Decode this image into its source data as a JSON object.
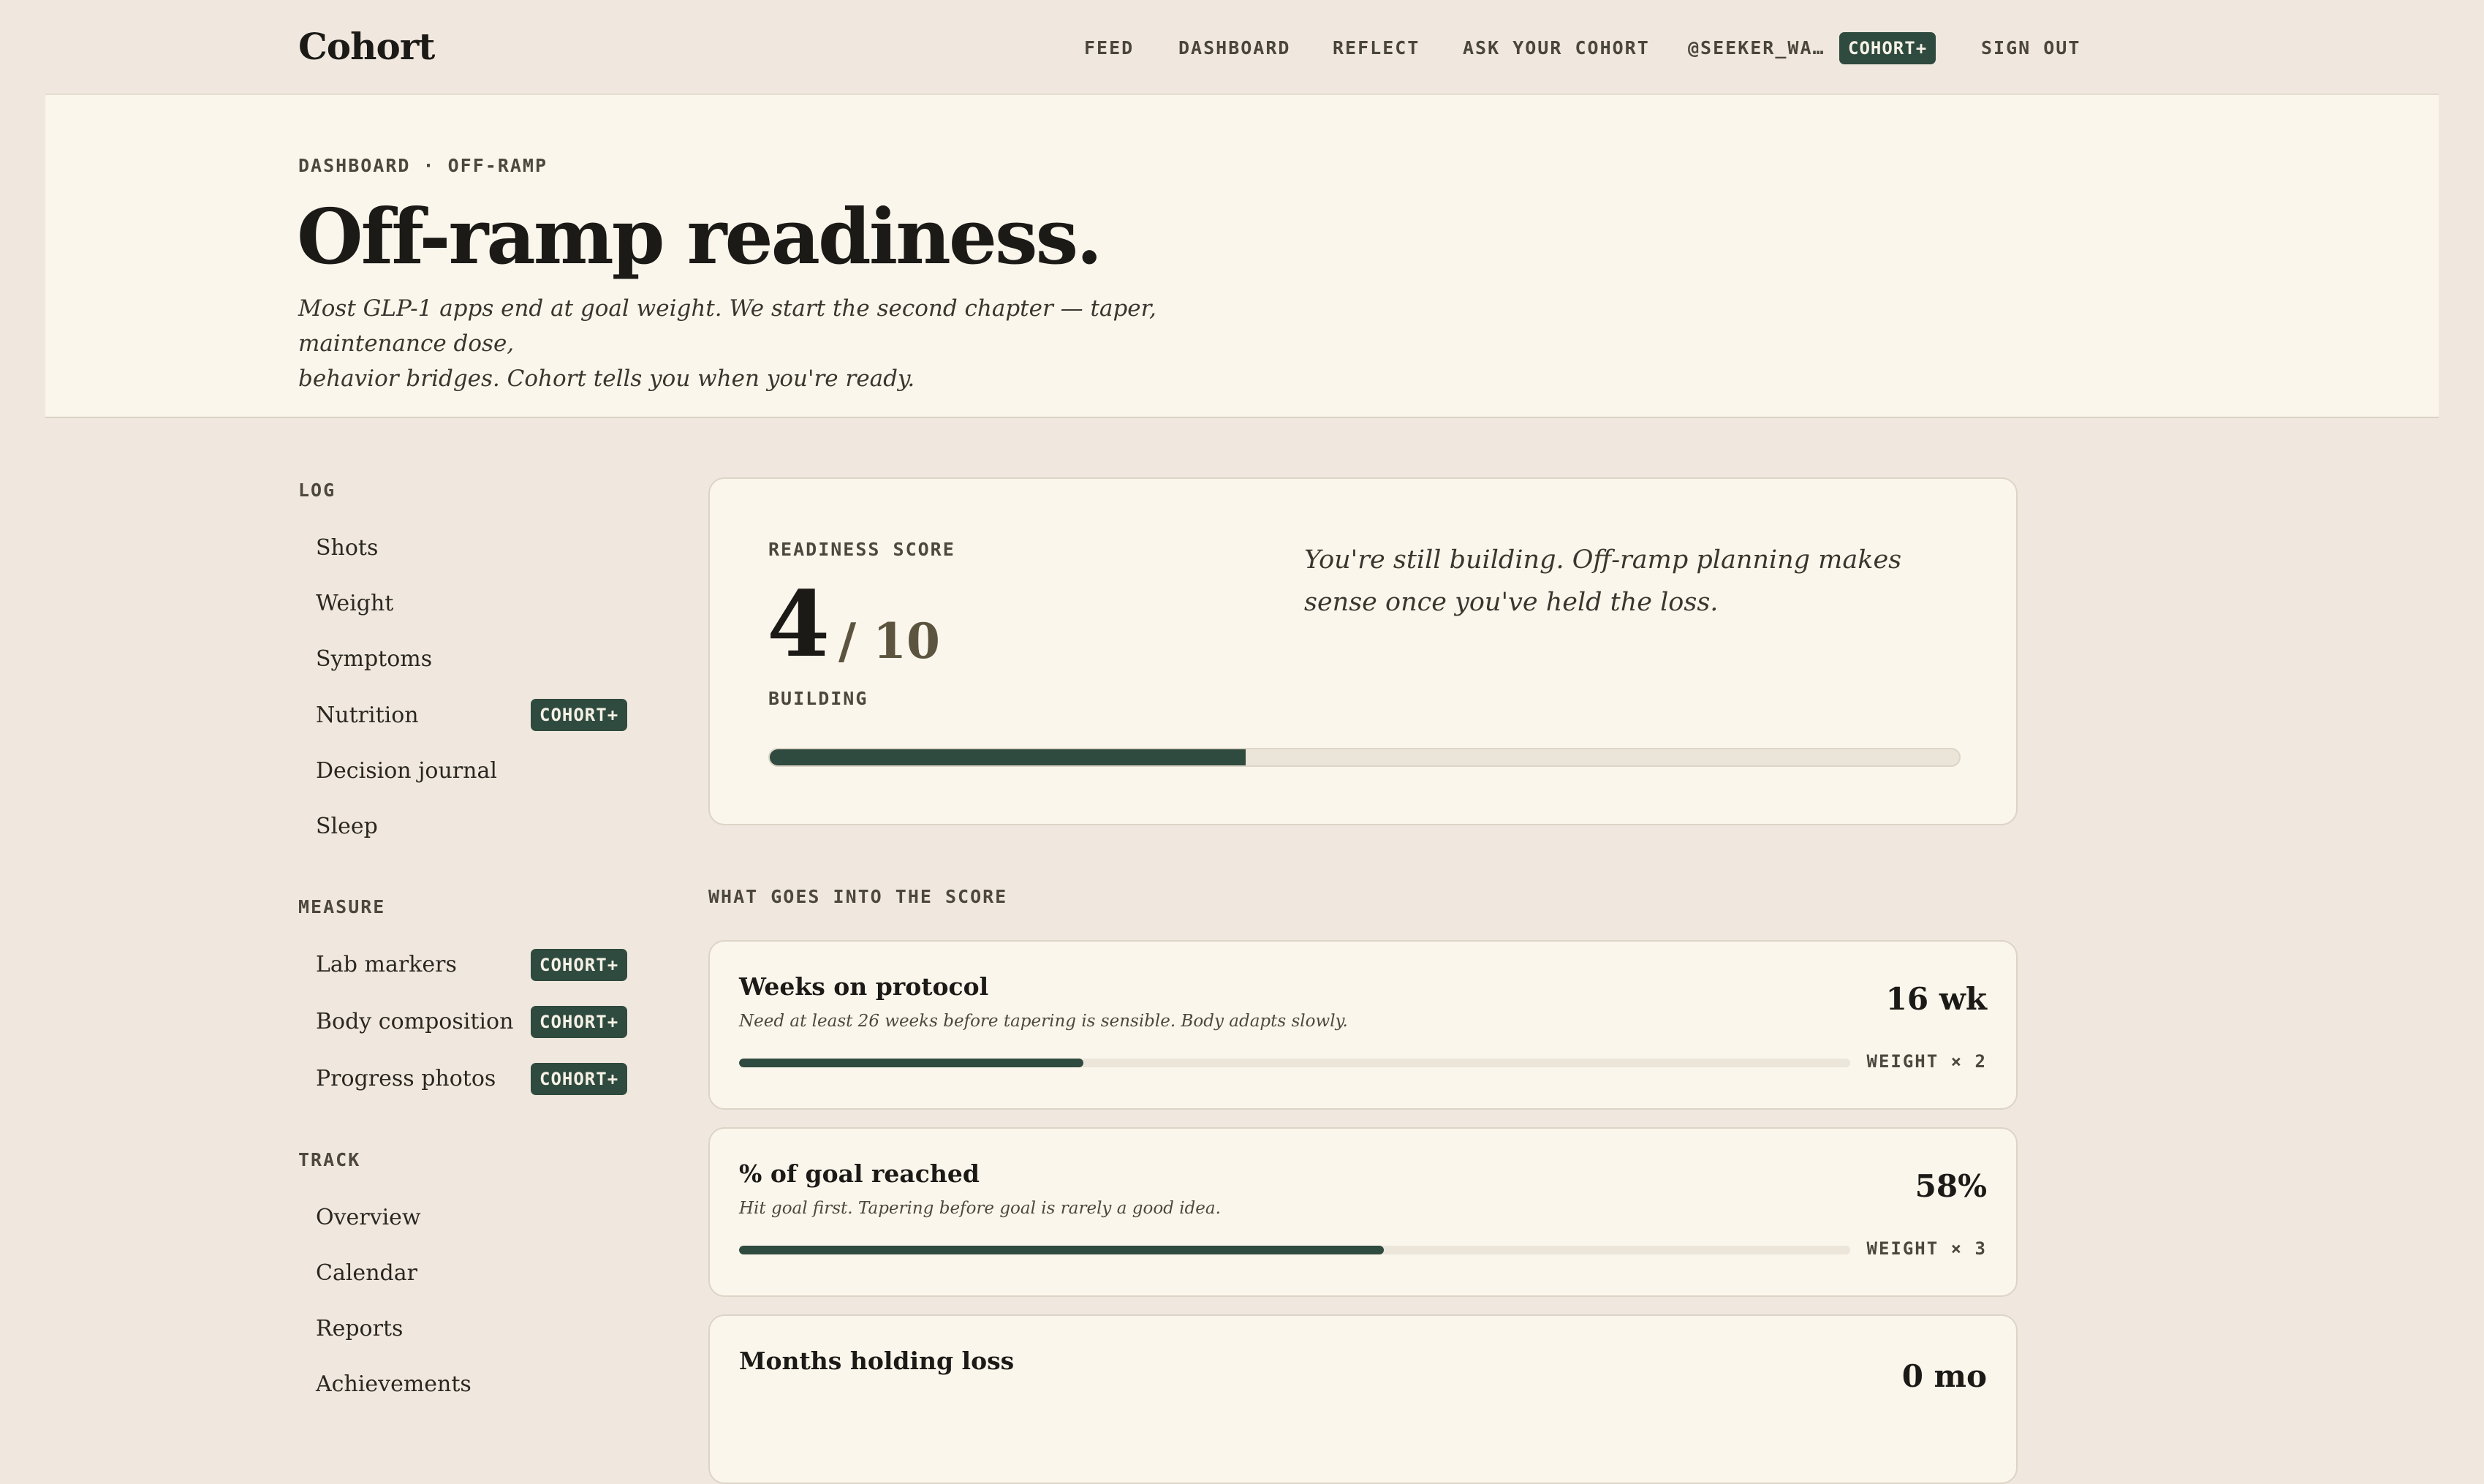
{
  "app": {
    "name": "Cohort"
  },
  "nav": {
    "items": [
      "FEED",
      "DASHBOARD",
      "REFLECT",
      "ASK YOUR COHORT",
      "@SEEKER_WA…"
    ],
    "badge": "COHORT+",
    "sign_out": "SIGN OUT"
  },
  "hero": {
    "breadcrumb": "DASHBOARD · OFF-RAMP",
    "title": "Off-ramp readiness.",
    "subtitle_line1": "Most GLP-1 apps end at goal weight. We start the second chapter — taper, maintenance dose,",
    "subtitle_line2": "behavior bridges. Cohort tells you when you're ready."
  },
  "sidebar": {
    "sections": [
      {
        "heading": "LOG",
        "items": [
          {
            "label": "Shots"
          },
          {
            "label": "Weight"
          },
          {
            "label": "Symptoms"
          },
          {
            "label": "Nutrition",
            "badge": "COHORT+"
          },
          {
            "label": "Decision journal"
          },
          {
            "label": "Sleep"
          }
        ]
      },
      {
        "heading": "MEASURE",
        "items": [
          {
            "label": "Lab markers",
            "badge": "COHORT+"
          },
          {
            "label": "Body composition",
            "badge": "COHORT+"
          },
          {
            "label": "Progress photos",
            "badge": "COHORT+"
          }
        ]
      },
      {
        "heading": "TRACK",
        "items": [
          {
            "label": "Overview"
          },
          {
            "label": "Calendar"
          },
          {
            "label": "Reports"
          },
          {
            "label": "Achievements"
          }
        ]
      }
    ]
  },
  "readiness": {
    "label": "READINESS SCORE",
    "score": "4",
    "denominator": "/ 10",
    "score_value": 4,
    "score_max": 10,
    "status": "BUILDING",
    "message": "You're still building. Off-ramp planning makes sense once you've held the loss."
  },
  "factors": {
    "heading": "WHAT GOES INTO THE SCORE",
    "items": [
      {
        "title": "Weeks on protocol",
        "description": "Need at least 26 weeks before tapering is sensible. Body adapts slowly.",
        "value": "16 wk",
        "progress": 0.31,
        "weight": "WEIGHT × 2"
      },
      {
        "title": "% of goal reached",
        "description": "Hit goal first. Tapering before goal is rarely a good idea.",
        "value": "58%",
        "progress": 0.58,
        "weight": "WEIGHT × 3"
      },
      {
        "title": "Months holding loss",
        "description": "",
        "value": "0 mo",
        "progress": 0,
        "weight": ""
      }
    ]
  },
  "colors": {
    "accent": "#2f4a3e",
    "background": "#f0e8de",
    "card": "#faf6ec"
  }
}
